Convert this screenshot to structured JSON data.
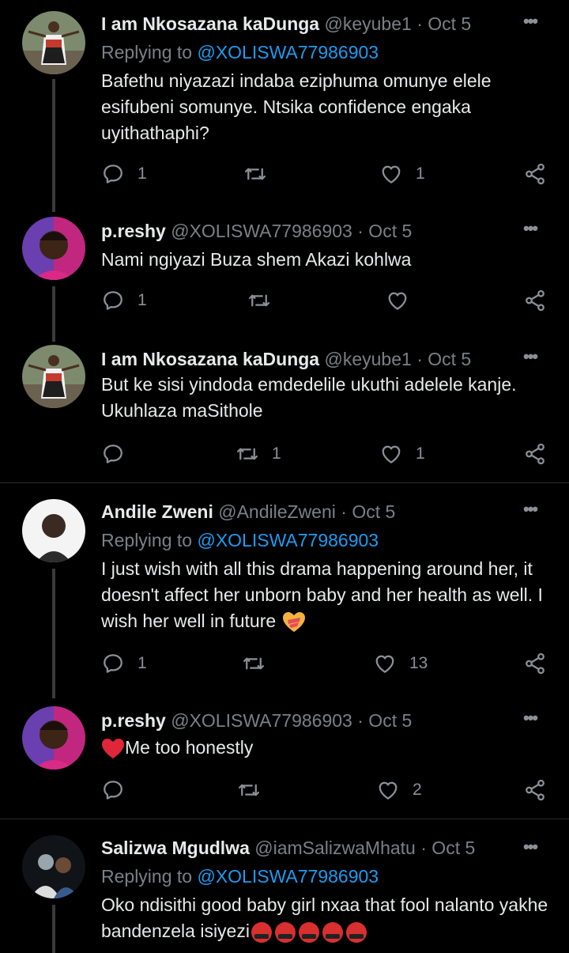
{
  "tweets": [
    {
      "name": "I am Nkosazana kaDunga",
      "handle": "@keyube1",
      "time": "· Oct 5",
      "more": "•••",
      "replying_label": "Replying to ",
      "replying_handle": "@XOLISWA77986903",
      "text": "Bafethu niyazazi indaba eziphuma omunye elele esifubeni somunye. Ntsika confidence engaka uyithathaphi?",
      "reply_count": "1",
      "retweet_count": "",
      "like_count": "1"
    },
    {
      "name": "p.reshy",
      "handle": "@XOLISWA77986903",
      "time": "· Oct 5",
      "more": "•••",
      "text": "Nami ngiyazi Buza shem Akazi kohlwa",
      "reply_count": "1",
      "retweet_count": "",
      "like_count": ""
    },
    {
      "name": "I am Nkosazana kaDunga",
      "handle": "@keyube1",
      "time": "· Oct 5",
      "more": "•••",
      "text": "But ke sisi yindoda emdedelile ukuthi adelele kanje. Ukuhlaza maSithole",
      "reply_count": "",
      "retweet_count": "1",
      "like_count": "1"
    },
    {
      "name": "Andile Zweni",
      "handle": "@AndileZweni",
      "time": "· Oct 5",
      "more": "•••",
      "replying_label": "Replying to ",
      "replying_handle": "@XOLISWA77986903",
      "text": "I just wish with all this drama happening around her, it doesn't affect her unborn baby and her health as well. I wish her well in future",
      "reply_count": "1",
      "retweet_count": "",
      "like_count": "13"
    },
    {
      "name": "p.reshy",
      "handle": "@XOLISWA77986903",
      "time": "· Oct 5",
      "more": "•••",
      "text": "Me too honestly",
      "reply_count": "",
      "retweet_count": "",
      "like_count": "2"
    },
    {
      "name": "Salizwa Mgudlwa",
      "handle": "@iamSalizwaMhatu",
      "time": "· Oct 5",
      "more": "•••",
      "replying_label": "Replying to ",
      "replying_handle": "@XOLISWA77986903",
      "text": "Oko ndisithi good baby girl nxaa that fool nalanto yakhe bandenzela isiyezi"
    }
  ],
  "icons": {
    "reply": "reply-icon",
    "retweet": "retweet-icon",
    "like": "heart-icon",
    "share": "share-icon",
    "sparkle_heart": "heart-on-fire-icon",
    "red_heart": "red-heart-icon",
    "cursing": "cursing-face-icon"
  },
  "colors": {
    "background": "#000000",
    "link": "#1d9bf0",
    "muted": "#7b8085",
    "separator": "#2a2a2a"
  }
}
